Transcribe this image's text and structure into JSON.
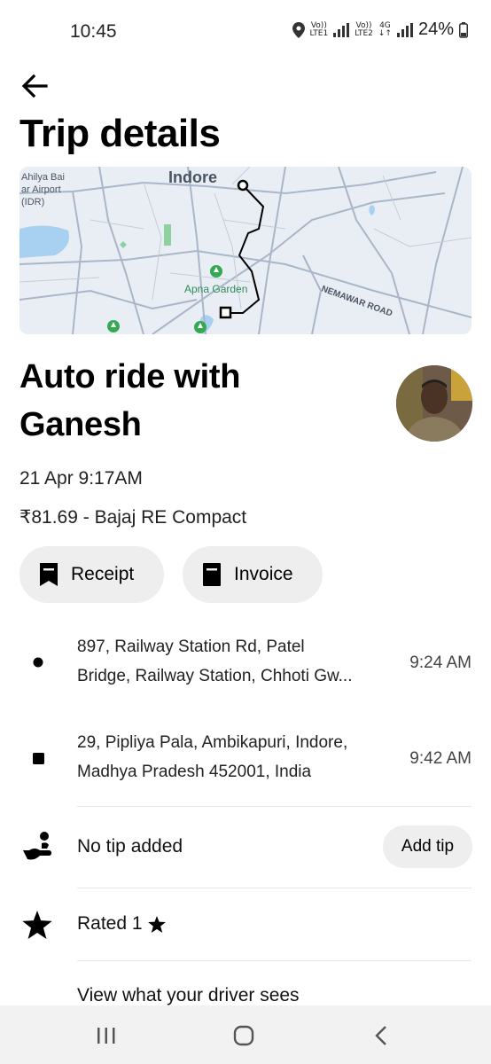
{
  "status_bar": {
    "time": "10:45",
    "sim1_top": "Vo))",
    "sim1_bottom": "LTE1",
    "sim2_top": "Vo))",
    "sim2_bottom": "LTE2",
    "network": "4G",
    "battery": "24%",
    "icons": [
      "location-icon",
      "signal-icon",
      "battery-icon"
    ]
  },
  "header": {
    "title": "Trip details"
  },
  "map": {
    "city_label": "Indore",
    "airport_label_line1": "Ahilya Bai",
    "airport_label_line2": "ar Airport",
    "airport_label_line3": "(IDR)",
    "poi_label": "Apna Garden",
    "road_label": "NEMAWAR ROAD"
  },
  "ride": {
    "title_line1": "Auto ride with",
    "title_line2": "Ganesh",
    "date": "21 Apr 9:17AM",
    "fare": "₹81.69 - Bajaj RE Compact"
  },
  "actions": {
    "receipt_label": "Receipt",
    "invoice_label": "Invoice"
  },
  "stops": [
    {
      "line1": "897, Railway Station Rd, Patel",
      "line2": "Bridge, Railway Station, Chhoti Gw...",
      "time": "9:24 AM"
    },
    {
      "line1": "29, Pipliya Pala, Ambikapuri, Indore,",
      "line2": "Madhya Pradesh 452001, India",
      "time": "9:42 AM"
    }
  ],
  "tip": {
    "label": "No tip added",
    "button_label": "Add tip"
  },
  "rating": {
    "label": "Rated 1"
  },
  "driver_view": {
    "label": "View what your driver sees"
  },
  "colors": {
    "pill_bg": "#eeeeee",
    "map_bg": "#e9eef4",
    "map_water": "#a8d0f0",
    "map_road": "#a9b6c8",
    "map_park": "#34a853"
  }
}
